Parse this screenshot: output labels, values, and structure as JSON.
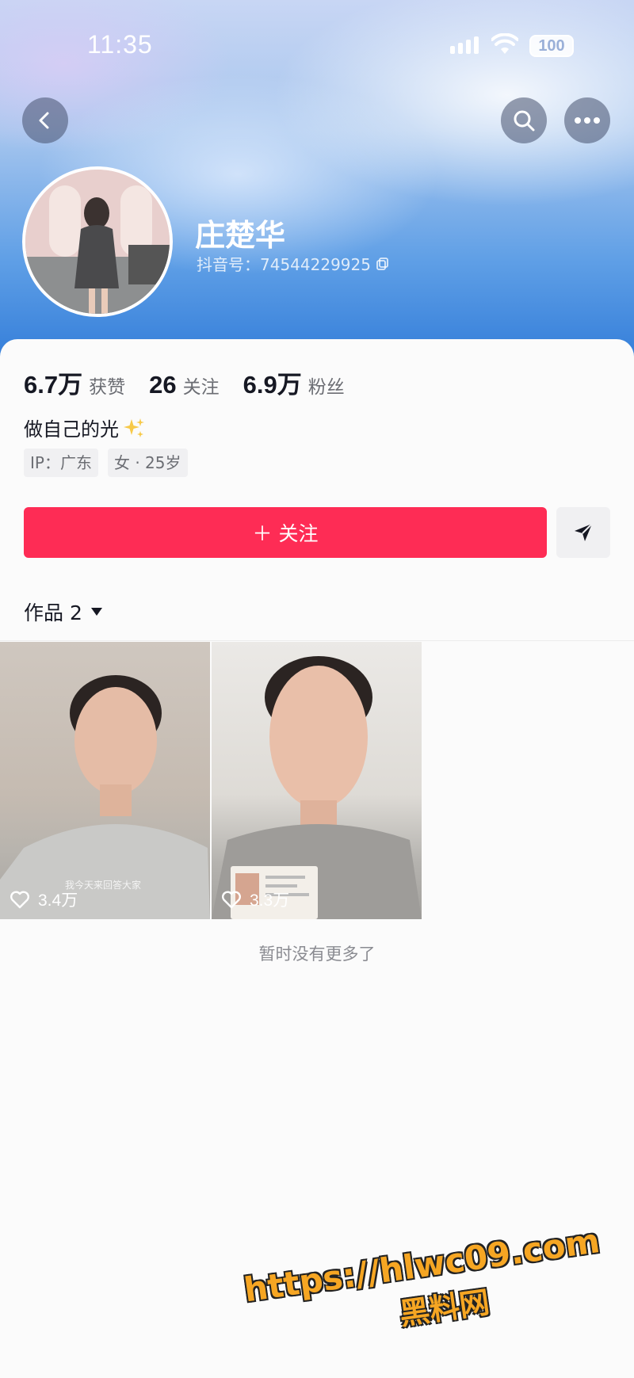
{
  "status_bar": {
    "time": "11:35",
    "battery": "100"
  },
  "profile": {
    "name": "庄楚华",
    "douyin_id": "抖音号：74544229925",
    "stats": [
      {
        "num": "6.7万",
        "label": "获赞"
      },
      {
        "num": "26",
        "label": "关注"
      },
      {
        "num": "6.9万",
        "label": "粉丝"
      }
    ],
    "bio": "做自己的光",
    "tags": [
      "IP：广东",
      "女 · 25岁"
    ]
  },
  "actions": {
    "follow_label": "＋ 关注"
  },
  "works": {
    "label": "作品 2",
    "items": [
      {
        "likes": "3.4万",
        "caption": "我今天来回答大家"
      },
      {
        "likes": "3.3万"
      }
    ],
    "no_more": "暂时没有更多了"
  },
  "watermark": {
    "url": "https://hlwc09.com",
    "site": "黑料网"
  },
  "icons": [
    "back-icon",
    "search-icon",
    "more-icon",
    "copy-icon",
    "sparkles-icon",
    "share-icon",
    "dropdown-icon",
    "heart-icon"
  ],
  "colors": {
    "accent": "#fe2c55",
    "watermark": "#f6a623"
  }
}
